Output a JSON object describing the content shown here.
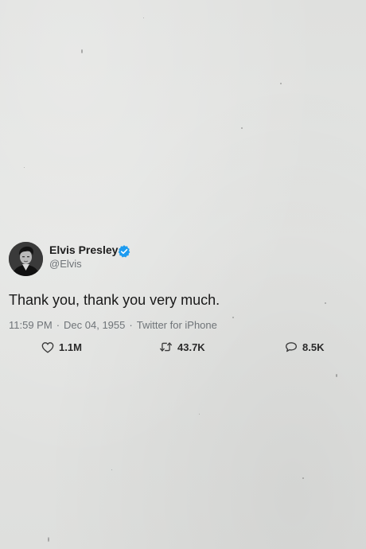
{
  "tweet": {
    "display_name": "Elvis Presley",
    "handle": "@Elvis",
    "verified_icon": "verified-badge-icon",
    "text": "Thank you, thank you very much.",
    "time": "11:59 PM",
    "date": "Dec 04, 1955",
    "separator": "·",
    "source": "Twitter for iPhone",
    "stats": {
      "likes": "1.1M",
      "retweets": "43.7K",
      "replies": "8.5K"
    },
    "icons": {
      "likes": "heart-icon",
      "retweets": "retweet-icon",
      "replies": "reply-icon"
    }
  },
  "colors": {
    "verified": "#1d9bf0",
    "background": "#e2e3e1",
    "secondary_text": "#6f7478"
  }
}
